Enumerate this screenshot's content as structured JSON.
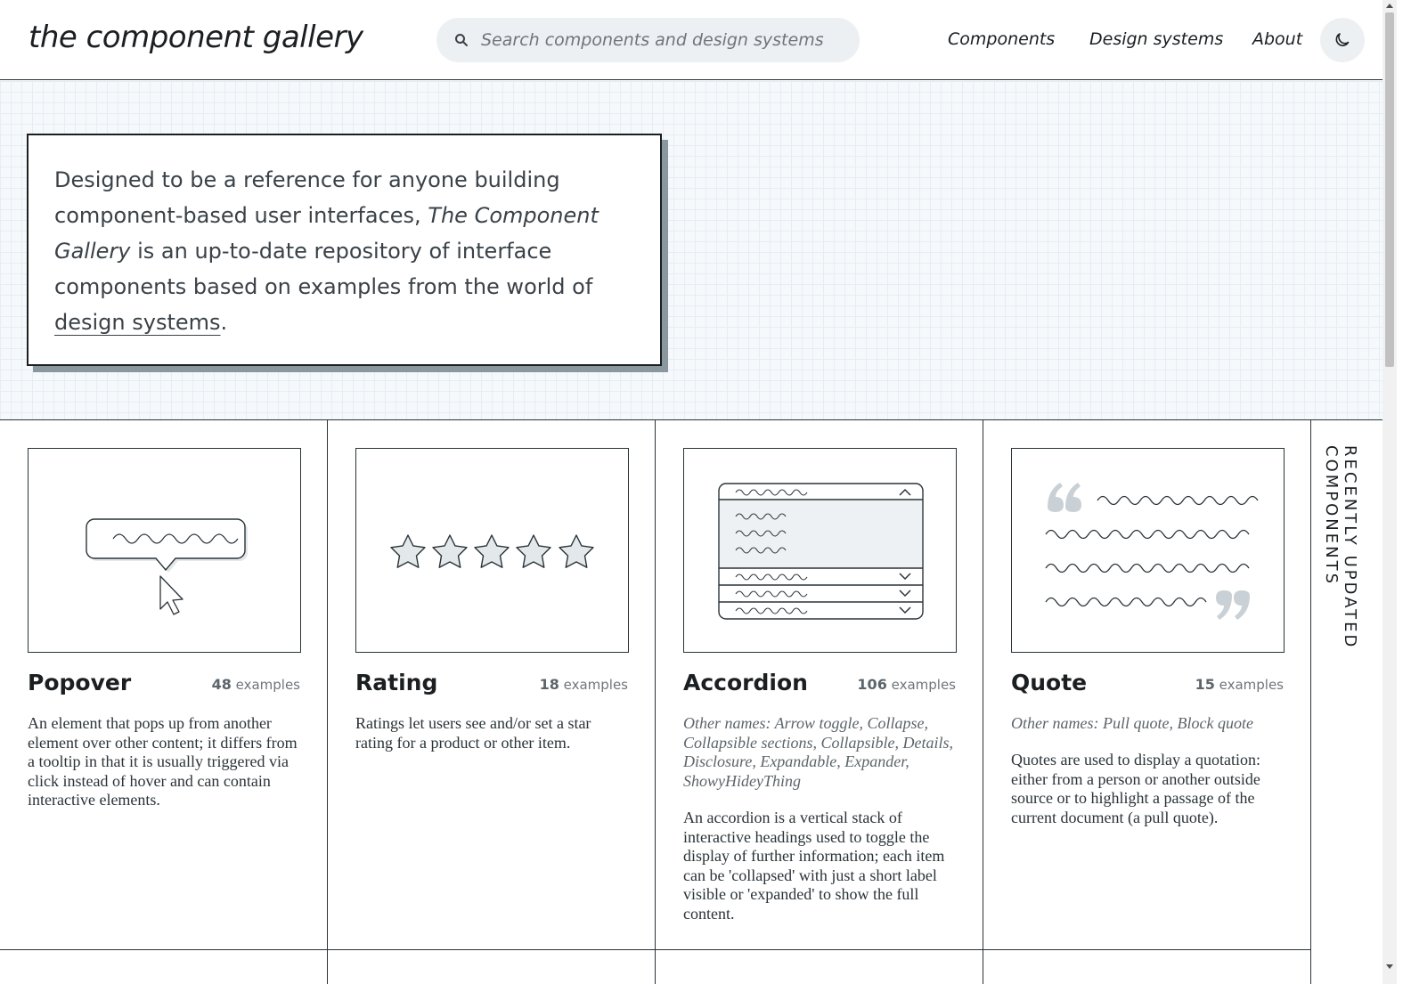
{
  "site": {
    "logo": "the component gallery"
  },
  "search": {
    "placeholder": "Search components and design systems"
  },
  "nav": {
    "components": "Components",
    "design_systems": "Design systems",
    "about": "About"
  },
  "hero": {
    "text_1": "Designed to be a reference for anyone building component-based user interfaces, ",
    "title_em": "The Component Gallery",
    "text_2": " is an up-to-date repository of interface components based on examples from the world of ",
    "link": "design systems",
    "text_3": "."
  },
  "recent_label": "RECENTLY UPDATED COMPONENTS",
  "components": [
    {
      "title": "Popover",
      "count": "48",
      "count_label": "examples",
      "other_names": "",
      "description": "An element that pops up from another element over other content; it differs from a tooltip in that it is usually triggered via click instead of hover and can contain interactive elements."
    },
    {
      "title": "Rating",
      "count": "18",
      "count_label": "examples",
      "other_names": "",
      "description": "Ratings let users see and/or set a star rating for a product or other item.",
      "stars": 5
    },
    {
      "title": "Accordion",
      "count": "106",
      "count_label": "examples",
      "other_names": "Other names: Arrow toggle, Collapse, Collapsible sections, Collapsible, Details, Disclosure, Expandable, Expander, ShowyHideyThing",
      "description": "An accordion is a vertical stack of interactive headings used to toggle the display of further information; each item can be 'collapsed' with just a short label visible or 'expanded' to show the full content."
    },
    {
      "title": "Quote",
      "count": "15",
      "count_label": "examples",
      "other_names": "Other names: Pull quote, Block quote",
      "description": "Quotes are used to display a quotation: either from a person or another outside source or to highlight a passage of the current document (a pull quote)."
    }
  ],
  "colors": {
    "accent": "#1b1f22",
    "hero_bg": "#f5f9fb",
    "search_bg": "#edf0f2",
    "shadow": "#8b979e"
  }
}
